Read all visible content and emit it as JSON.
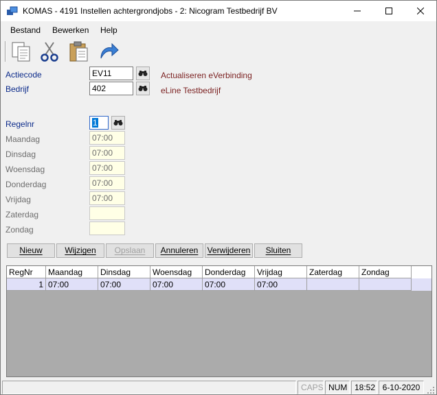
{
  "window": {
    "title": "KOMAS - 4191 Instellen achtergrondjobs - 2: Nicogram Testbedrijf BV",
    "minimize_glyph": "—",
    "maximize_glyph": "☐",
    "close_glyph": "✕"
  },
  "menu": {
    "items": [
      {
        "label": "Bestand"
      },
      {
        "label": "Bewerken"
      },
      {
        "label": "Help"
      }
    ]
  },
  "toolbar": {
    "icons": [
      "copy-icon",
      "cut-icon",
      "paste-icon",
      "undo-icon"
    ]
  },
  "form": {
    "actiecode": {
      "label": "Actiecode",
      "value": "EV11",
      "description": "Actualiseren eVerbinding"
    },
    "bedrijf": {
      "label": "Bedrijf",
      "value": "402",
      "description": "eLine Testbedrijf"
    },
    "regelnr": {
      "label": "Regelnr",
      "value": "1"
    },
    "days": [
      {
        "label": "Maandag",
        "value": "07:00"
      },
      {
        "label": "Dinsdag",
        "value": "07:00"
      },
      {
        "label": "Woensdag",
        "value": "07:00"
      },
      {
        "label": "Donderdag",
        "value": "07:00"
      },
      {
        "label": "Vrijdag",
        "value": "07:00"
      },
      {
        "label": "Zaterdag",
        "value": ""
      },
      {
        "label": "Zondag",
        "value": ""
      }
    ]
  },
  "buttons": {
    "nieuw": "Nieuw",
    "wijzigen": "Wijzigen",
    "opslaan": "Opslaan",
    "annuleren": "Annuleren",
    "verwijderen": "Verwijderen",
    "sluiten": "Sluiten"
  },
  "grid": {
    "columns": [
      "RegNr",
      "Maandag",
      "Dinsdag",
      "Woensdag",
      "Donderdag",
      "Vrijdag",
      "Zaterdag",
      "Zondag"
    ],
    "rows": [
      [
        "1",
        "07:00",
        "07:00",
        "07:00",
        "07:00",
        "07:00",
        "",
        ""
      ]
    ]
  },
  "status": {
    "caps": "CAPS",
    "num": "NUM",
    "time": "18:52",
    "date": "6-10-2020"
  },
  "colors": {
    "label_blue": "#0b2a8a",
    "description_red": "#7a1f1f",
    "readonly_bg": "#ffffe6",
    "selected_row": "#e0e0f8",
    "grid_bg": "#ababab"
  }
}
